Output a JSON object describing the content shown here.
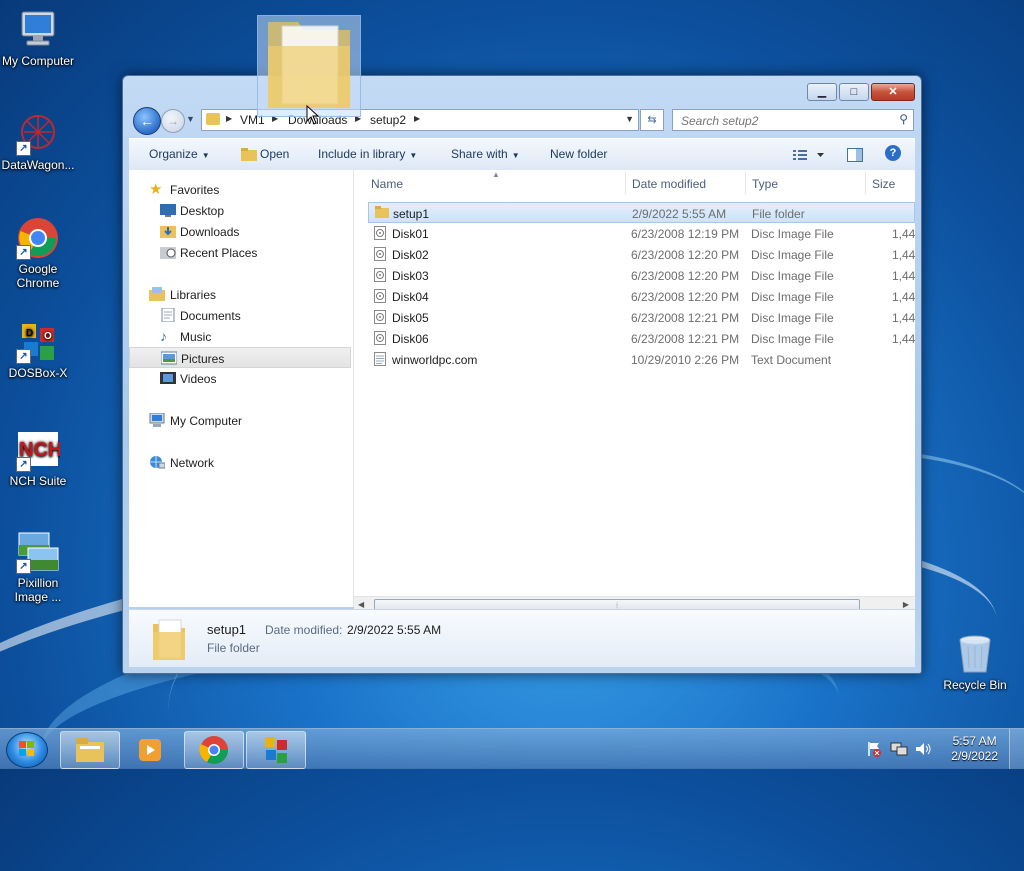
{
  "desktop": {
    "icons": [
      {
        "label": "My Computer"
      },
      {
        "label": "DataWagon..."
      },
      {
        "label": "Google Chrome"
      },
      {
        "label": "DOSBox-X"
      },
      {
        "label": "NCH Suite"
      },
      {
        "label": "Pixillion Image ..."
      },
      {
        "label": "Recycle Bin"
      }
    ]
  },
  "window": {
    "caption_buttons": {
      "minimize": "▁",
      "maximize": "□",
      "close": "✕"
    },
    "address": {
      "crumbs": [
        "VM1",
        "Downloads",
        "setup2"
      ]
    },
    "search": {
      "placeholder": "Search setup2"
    },
    "toolbar": {
      "organize": "Organize",
      "open": "Open",
      "include_in_library": "Include in library",
      "share_with": "Share with",
      "new_folder": "New folder"
    },
    "nav": {
      "favorites": "Favorites",
      "desktop": "Desktop",
      "downloads": "Downloads",
      "recent_places": "Recent Places",
      "libraries": "Libraries",
      "documents": "Documents",
      "music": "Music",
      "pictures": "Pictures",
      "videos": "Videos",
      "my_computer": "My Computer",
      "network": "Network"
    },
    "columns": {
      "name": "Name",
      "date_modified": "Date modified",
      "type": "Type",
      "size": "Size"
    },
    "files": [
      {
        "name": "setup1",
        "date": "2/9/2022 5:55 AM",
        "type": "File folder",
        "size": ""
      },
      {
        "name": "Disk01",
        "date": "6/23/2008 12:19 PM",
        "type": "Disc Image File",
        "size": "1,44"
      },
      {
        "name": "Disk02",
        "date": "6/23/2008 12:20 PM",
        "type": "Disc Image File",
        "size": "1,44"
      },
      {
        "name": "Disk03",
        "date": "6/23/2008 12:20 PM",
        "type": "Disc Image File",
        "size": "1,44"
      },
      {
        "name": "Disk04",
        "date": "6/23/2008 12:20 PM",
        "type": "Disc Image File",
        "size": "1,44"
      },
      {
        "name": "Disk05",
        "date": "6/23/2008 12:21 PM",
        "type": "Disc Image File",
        "size": "1,44"
      },
      {
        "name": "Disk06",
        "date": "6/23/2008 12:21 PM",
        "type": "Disc Image File",
        "size": "1,44"
      },
      {
        "name": "winworldpc.com",
        "date": "10/29/2010 2:26 PM",
        "type": "Text Document",
        "size": ""
      }
    ],
    "details": {
      "name": "setup1",
      "date_label": "Date modified:",
      "date_value": "2/9/2022 5:55 AM",
      "type": "File folder"
    }
  },
  "taskbar": {
    "time": "5:57 AM",
    "date": "2/9/2022"
  }
}
